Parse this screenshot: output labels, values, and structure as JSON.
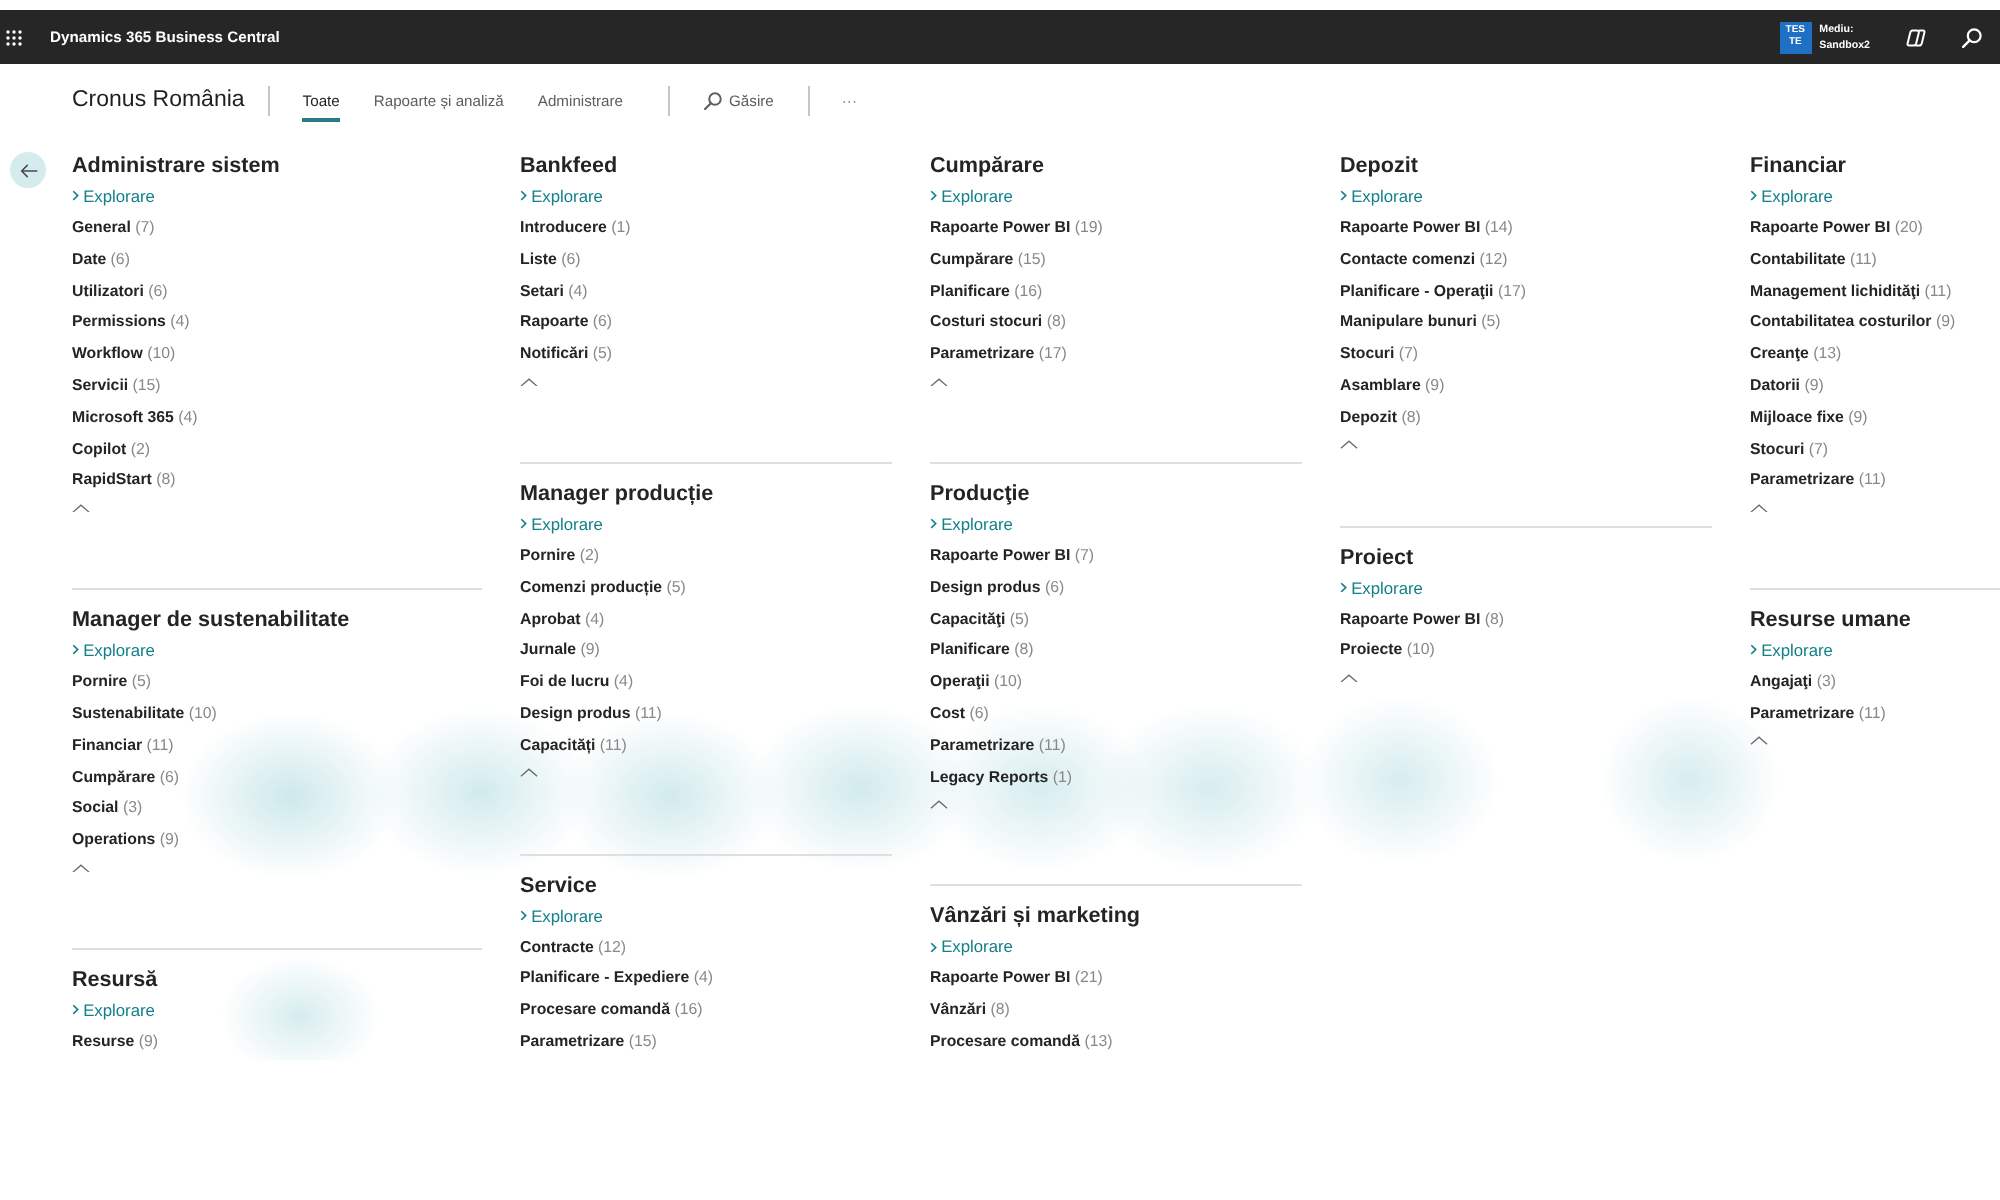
{
  "top_bar": {
    "app_title": "Dynamics 365 Business Central",
    "environment": {
      "badge_lines": [
        "TES",
        "TE"
      ],
      "label": "Mediu:",
      "name": "Sandbox2"
    }
  },
  "nav": {
    "company": "Cronus România",
    "tabs": [
      {
        "label": "Toate",
        "selected": true
      },
      {
        "label": "Rapoarte și analiză",
        "selected": false
      },
      {
        "label": "Administrare",
        "selected": false
      }
    ],
    "search": "Găsire",
    "more": "···"
  },
  "columns": [
    {
      "groups": [
        {
          "title": "Administrare sistem",
          "explore": "Explorare",
          "expanded": true,
          "items": [
            {
              "label": "General",
              "count": "(7)"
            },
            {
              "label": "Date",
              "count": "(6)"
            },
            {
              "label": "Utilizatori",
              "count": "(6)"
            },
            {
              "label": "Permissions",
              "count": "(4)"
            },
            {
              "label": "Workflow",
              "count": "(10)"
            },
            {
              "label": "Servicii",
              "count": "(15)"
            },
            {
              "label": "Microsoft 365",
              "count": "(4)"
            },
            {
              "label": "Copilot",
              "count": "(2)"
            },
            {
              "label": "RapidStart",
              "count": "(8)"
            }
          ]
        },
        {
          "title": "Manager de sustenabilitate",
          "explore": "Explorare",
          "expanded": true,
          "items": [
            {
              "label": "Pornire",
              "count": "(5)"
            },
            {
              "label": "Sustenabilitate",
              "count": "(10)"
            },
            {
              "label": "Financiar",
              "count": "(11)"
            },
            {
              "label": "Cumpărare",
              "count": "(6)"
            },
            {
              "label": "Social",
              "count": "(3)"
            },
            {
              "label": "Operations",
              "count": "(9)"
            }
          ]
        },
        {
          "title": "Resursă",
          "explore": "Explorare",
          "items": [
            {
              "label": "Resurse",
              "count": "(9)"
            }
          ]
        }
      ]
    },
    {
      "groups": [
        {
          "title": "Bankfeed",
          "explore": "Explorare",
          "expanded": true,
          "items": [
            {
              "label": "Introducere",
              "count": "(1)"
            },
            {
              "label": "Liste",
              "count": "(6)"
            },
            {
              "label": "Setari",
              "count": "(4)"
            },
            {
              "label": "Rapoarte",
              "count": "(6)"
            },
            {
              "label": "Notificări",
              "count": "(5)"
            }
          ]
        },
        {
          "title": "Manager producție",
          "explore": "Explorare",
          "expanded": true,
          "items": [
            {
              "label": "Pornire",
              "count": "(2)"
            },
            {
              "label": "Comenzi producție",
              "count": "(5)"
            },
            {
              "label": "Aprobat",
              "count": "(4)"
            },
            {
              "label": "Jurnale",
              "count": "(9)"
            },
            {
              "label": "Foi de lucru",
              "count": "(4)"
            },
            {
              "label": "Design produs",
              "count": "(11)"
            },
            {
              "label": "Capacități",
              "count": "(11)"
            }
          ]
        },
        {
          "title": "Service",
          "explore": "Explorare",
          "items": [
            {
              "label": "Contracte",
              "count": "(12)"
            },
            {
              "label": "Planificare - Expediere",
              "count": "(4)"
            },
            {
              "label": "Procesare comandă",
              "count": "(16)"
            },
            {
              "label": "Parametrizare",
              "count": "(15)"
            }
          ]
        }
      ]
    },
    {
      "groups": [
        {
          "title": "Cumpărare",
          "explore": "Explorare",
          "expanded": true,
          "items": [
            {
              "label": "Rapoarte Power BI",
              "count": "(19)"
            },
            {
              "label": "Cumpărare",
              "count": "(15)"
            },
            {
              "label": "Planificare",
              "count": "(16)"
            },
            {
              "label": "Costuri stocuri",
              "count": "(8)"
            },
            {
              "label": "Parametrizare",
              "count": "(17)"
            }
          ]
        },
        {
          "title": "Producţie",
          "explore": "Explorare",
          "expanded": true,
          "items": [
            {
              "label": "Rapoarte Power BI",
              "count": "(7)"
            },
            {
              "label": "Design produs",
              "count": "(6)"
            },
            {
              "label": "Capacităţi",
              "count": "(5)"
            },
            {
              "label": "Planificare",
              "count": "(8)"
            },
            {
              "label": "Operaţii",
              "count": "(10)"
            },
            {
              "label": "Cost",
              "count": "(6)"
            },
            {
              "label": "Parametrizare",
              "count": "(11)"
            },
            {
              "label": "Legacy Reports",
              "count": "(1)"
            }
          ]
        },
        {
          "title": "Vânzări și marketing",
          "explore": "Explorare",
          "items": [
            {
              "label": "Rapoarte Power BI",
              "count": "(21)"
            },
            {
              "label": "Vânzări",
              "count": "(8)"
            },
            {
              "label": "Procesare comandă",
              "count": "(13)"
            }
          ]
        }
      ]
    },
    {
      "groups": [
        {
          "title": "Depozit",
          "explore": "Explorare",
          "expanded": true,
          "items": [
            {
              "label": "Rapoarte Power BI",
              "count": "(14)"
            },
            {
              "label": "Contacte comenzi",
              "count": "(12)"
            },
            {
              "label": "Planificare - Operaţii",
              "count": "(17)"
            },
            {
              "label": "Manipulare bunuri",
              "count": "(5)"
            },
            {
              "label": "Stocuri",
              "count": "(7)"
            },
            {
              "label": "Asamblare",
              "count": "(9)"
            },
            {
              "label": "Depozit",
              "count": "(8)"
            }
          ]
        },
        {
          "title": "Proiect",
          "explore": "Explorare",
          "expanded": true,
          "items": [
            {
              "label": "Rapoarte Power BI",
              "count": "(8)"
            },
            {
              "label": "Proiecte",
              "count": "(10)"
            }
          ]
        }
      ]
    },
    {
      "groups": [
        {
          "title": "Financiar",
          "explore": "Explorare",
          "expanded": true,
          "items": [
            {
              "label": "Rapoarte Power BI",
              "count": "(20)"
            },
            {
              "label": "Contabilitate",
              "count": "(11)"
            },
            {
              "label": "Management lichidităţi",
              "count": "(11)"
            },
            {
              "label": "Contabilitatea costurilor",
              "count": "(9)"
            },
            {
              "label": "Creanţe",
              "count": "(13)"
            },
            {
              "label": "Datorii",
              "count": "(9)"
            },
            {
              "label": "Mijloace fixe",
              "count": "(9)"
            },
            {
              "label": "Stocuri",
              "count": "(7)"
            },
            {
              "label": "Parametrizare",
              "count": "(11)"
            }
          ]
        },
        {
          "title": "Resurse umane",
          "explore": "Explorare",
          "expanded": true,
          "items": [
            {
              "label": "Angajaţi",
              "count": "(3)"
            },
            {
              "label": "Parametrizare",
              "count": "(11)"
            }
          ]
        }
      ]
    }
  ]
}
